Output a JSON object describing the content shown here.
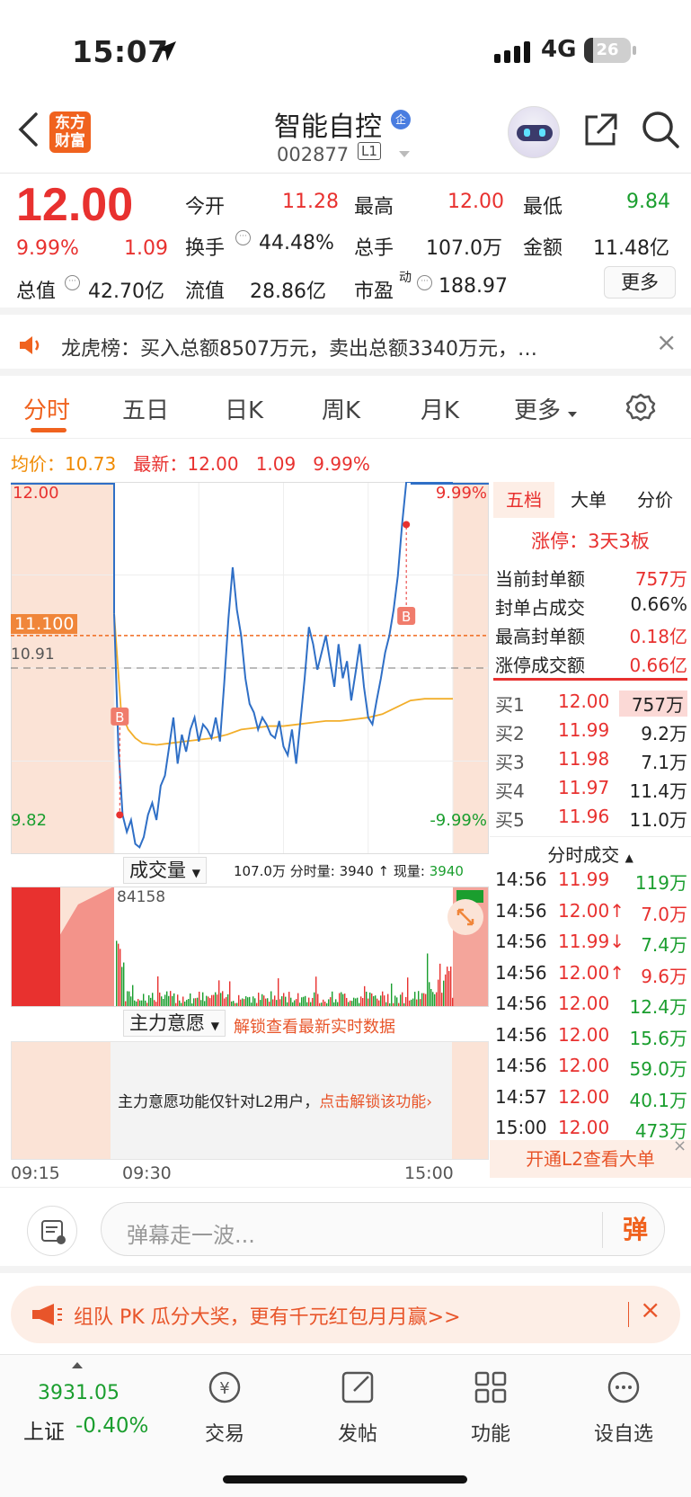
{
  "status_bar": {
    "time": "15:07",
    "network": "4G",
    "battery": "26"
  },
  "header": {
    "logo_text": "东方\n财富",
    "stock_name": "智能自控",
    "name_badge": "企",
    "stock_code": "002877",
    "level_badge": "L1"
  },
  "quote": {
    "price": "12.00",
    "change_pct": "9.99%",
    "change": "1.09",
    "open_label": "今开",
    "open": "11.28",
    "high_label": "最高",
    "high": "12.00",
    "low_label": "最低",
    "low": "9.84",
    "turnover_label": "换手",
    "turnover": "44.48%",
    "volume_label": "总手",
    "volume": "107.0万",
    "amount_label": "金额",
    "amount": "11.48亿",
    "mktcap_label": "总值",
    "mktcap": "42.70亿",
    "float_label": "流值",
    "float_cap": "28.86亿",
    "pe_label": "市盈",
    "pe_sup": "动",
    "pe": "188.97",
    "more_button": "更多"
  },
  "notice": {
    "text": "龙虎榜：买入总额8507万元，卖出总额3340万元，…"
  },
  "tabs": [
    "分时",
    "五日",
    "日K",
    "周K",
    "月K",
    "更多"
  ],
  "chart_info": {
    "avg_label": "均价：",
    "avg": "10.73",
    "latest_label": "最新：",
    "latest": "12.00",
    "chg": "1.09",
    "pct": "9.99%"
  },
  "chart_data": {
    "type": "line",
    "title": "",
    "y_labels": {
      "top": "12.00",
      "bottom": "9.82",
      "top_pct": "9.99%",
      "bottom_pct": "-9.99%",
      "prev_close": "10.91",
      "current_line": "11.100"
    },
    "ylim": [
      9.82,
      12.0
    ],
    "prev_close": 10.91,
    "marker": "B",
    "series": [
      {
        "name": "",
        "color": "#2f6fc6",
        "x": [
          0,
          3,
          6,
          9,
          12,
          15,
          18,
          21,
          24,
          27,
          30,
          33,
          36,
          39,
          42,
          45,
          48,
          51,
          54,
          57,
          60,
          63,
          66,
          69,
          72,
          75,
          78,
          81,
          84,
          87,
          90,
          93,
          96,
          99,
          102,
          105,
          108,
          111,
          114,
          117,
          120,
          123,
          126,
          129,
          132,
          135,
          138,
          141,
          144,
          147,
          150,
          153,
          156,
          159,
          162,
          165,
          168,
          171,
          174,
          177,
          180,
          183,
          186,
          189,
          192,
          195,
          198,
          201,
          204,
          207,
          210,
          213,
          216,
          219,
          222,
          225,
          228,
          231,
          234,
          237,
          240
        ],
        "y": [
          11.23,
          10.45,
          10.05,
          9.95,
          10.02,
          9.88,
          9.86,
          9.92,
          10.05,
          10.12,
          10.02,
          10.22,
          10.28,
          10.45,
          10.62,
          10.35,
          10.52,
          10.42,
          10.55,
          10.62,
          10.48,
          10.58,
          10.55,
          10.5,
          10.62,
          10.48,
          10.82,
          11.2,
          11.5,
          11.25,
          11.1,
          10.85,
          10.7,
          10.65,
          10.55,
          10.62,
          10.58,
          10.52,
          10.5,
          10.6,
          10.45,
          10.4,
          10.55,
          10.35,
          10.6,
          10.85,
          11.15,
          11.05,
          10.9,
          11.0,
          11.1,
          10.95,
          10.8,
          11.05,
          10.85,
          10.95,
          10.72,
          10.88,
          11.05,
          10.8,
          10.62,
          10.58,
          10.72,
          10.85,
          11.0,
          11.1,
          11.25,
          11.45,
          11.75,
          12.0,
          12.0,
          12.0,
          12.0,
          12.0,
          12.0,
          12.0,
          12.0,
          12.0,
          12.0,
          12.0,
          12.0
        ]
      },
      {
        "name": "",
        "color": "#f2ae2a",
        "x": [
          0,
          5,
          10,
          15,
          20,
          30,
          40,
          50,
          60,
          70,
          80,
          90,
          100,
          110,
          120,
          130,
          140,
          150,
          160,
          170,
          180,
          190,
          200,
          210,
          220,
          230,
          240
        ],
        "y": [
          11.23,
          10.65,
          10.55,
          10.5,
          10.47,
          10.46,
          10.47,
          10.48,
          10.49,
          10.5,
          10.52,
          10.55,
          10.56,
          10.57,
          10.57,
          10.58,
          10.59,
          10.6,
          10.6,
          10.61,
          10.62,
          10.64,
          10.68,
          10.72,
          10.73,
          10.73,
          10.73
        ]
      }
    ]
  },
  "volume_header": {
    "select": "成交量",
    "total": "107.0万",
    "interval_label": "分时量:",
    "interval": "3940",
    "now_label": "现量:",
    "now": "3940",
    "max_label": "84158"
  },
  "main_header": {
    "select": "主力意愿",
    "unlock": "解锁查看最新实时数据"
  },
  "main_box": {
    "text": "主力意愿功能仅针对L2用户，",
    "link": "点击解锁该功能"
  },
  "time_axis": [
    "09:15",
    "09:30",
    "15:00"
  ],
  "right_panel": {
    "tabs": [
      "五档",
      "大单",
      "分价"
    ],
    "limit_title": "涨停：3天3板",
    "stats": [
      {
        "label": "当前封单额",
        "value": "757万"
      },
      {
        "label": "封单占成交",
        "value": "0.66%"
      },
      {
        "label": "最高封单额",
        "value": "0.18亿"
      },
      {
        "label": "涨停成交额",
        "value": "0.66亿"
      }
    ],
    "bids": [
      {
        "label": "买1",
        "price": "12.00",
        "vol": "757万"
      },
      {
        "label": "买2",
        "price": "11.99",
        "vol": "9.2万"
      },
      {
        "label": "买3",
        "price": "11.98",
        "vol": "7.1万"
      },
      {
        "label": "买4",
        "price": "11.97",
        "vol": "11.4万"
      },
      {
        "label": "买5",
        "price": "11.96",
        "vol": "11.0万"
      }
    ],
    "trades_title": "分时成交",
    "trades": [
      {
        "time": "14:56",
        "price": "11.99",
        "vol": "119万"
      },
      {
        "time": "14:56",
        "price": "12.00↑",
        "vol": "7.0万"
      },
      {
        "time": "14:56",
        "price": "11.99↓",
        "vol": "7.4万"
      },
      {
        "time": "14:56",
        "price": "12.00↑",
        "vol": "9.6万"
      },
      {
        "time": "14:56",
        "price": "12.00",
        "vol": "12.4万"
      },
      {
        "time": "14:56",
        "price": "12.00",
        "vol": "15.6万"
      },
      {
        "time": "14:56",
        "price": "12.00",
        "vol": "59.0万"
      },
      {
        "time": "14:57",
        "price": "12.00",
        "vol": "40.1万"
      },
      {
        "time": "15:00",
        "price": "12.00",
        "vol": "473万"
      }
    ],
    "l2_banner": "开通L2查看大单"
  },
  "danmu": {
    "placeholder": "弹幕走一波...",
    "button": "弹"
  },
  "promo": {
    "text": "组队 PK 瓜分大奖，更有千元红包月月赢>>"
  },
  "bottom_nav": {
    "index_value": "3931.05",
    "index_name": "上证",
    "index_chg": "-0.40%",
    "items": [
      "交易",
      "发帖",
      "功能",
      "设自选"
    ]
  }
}
